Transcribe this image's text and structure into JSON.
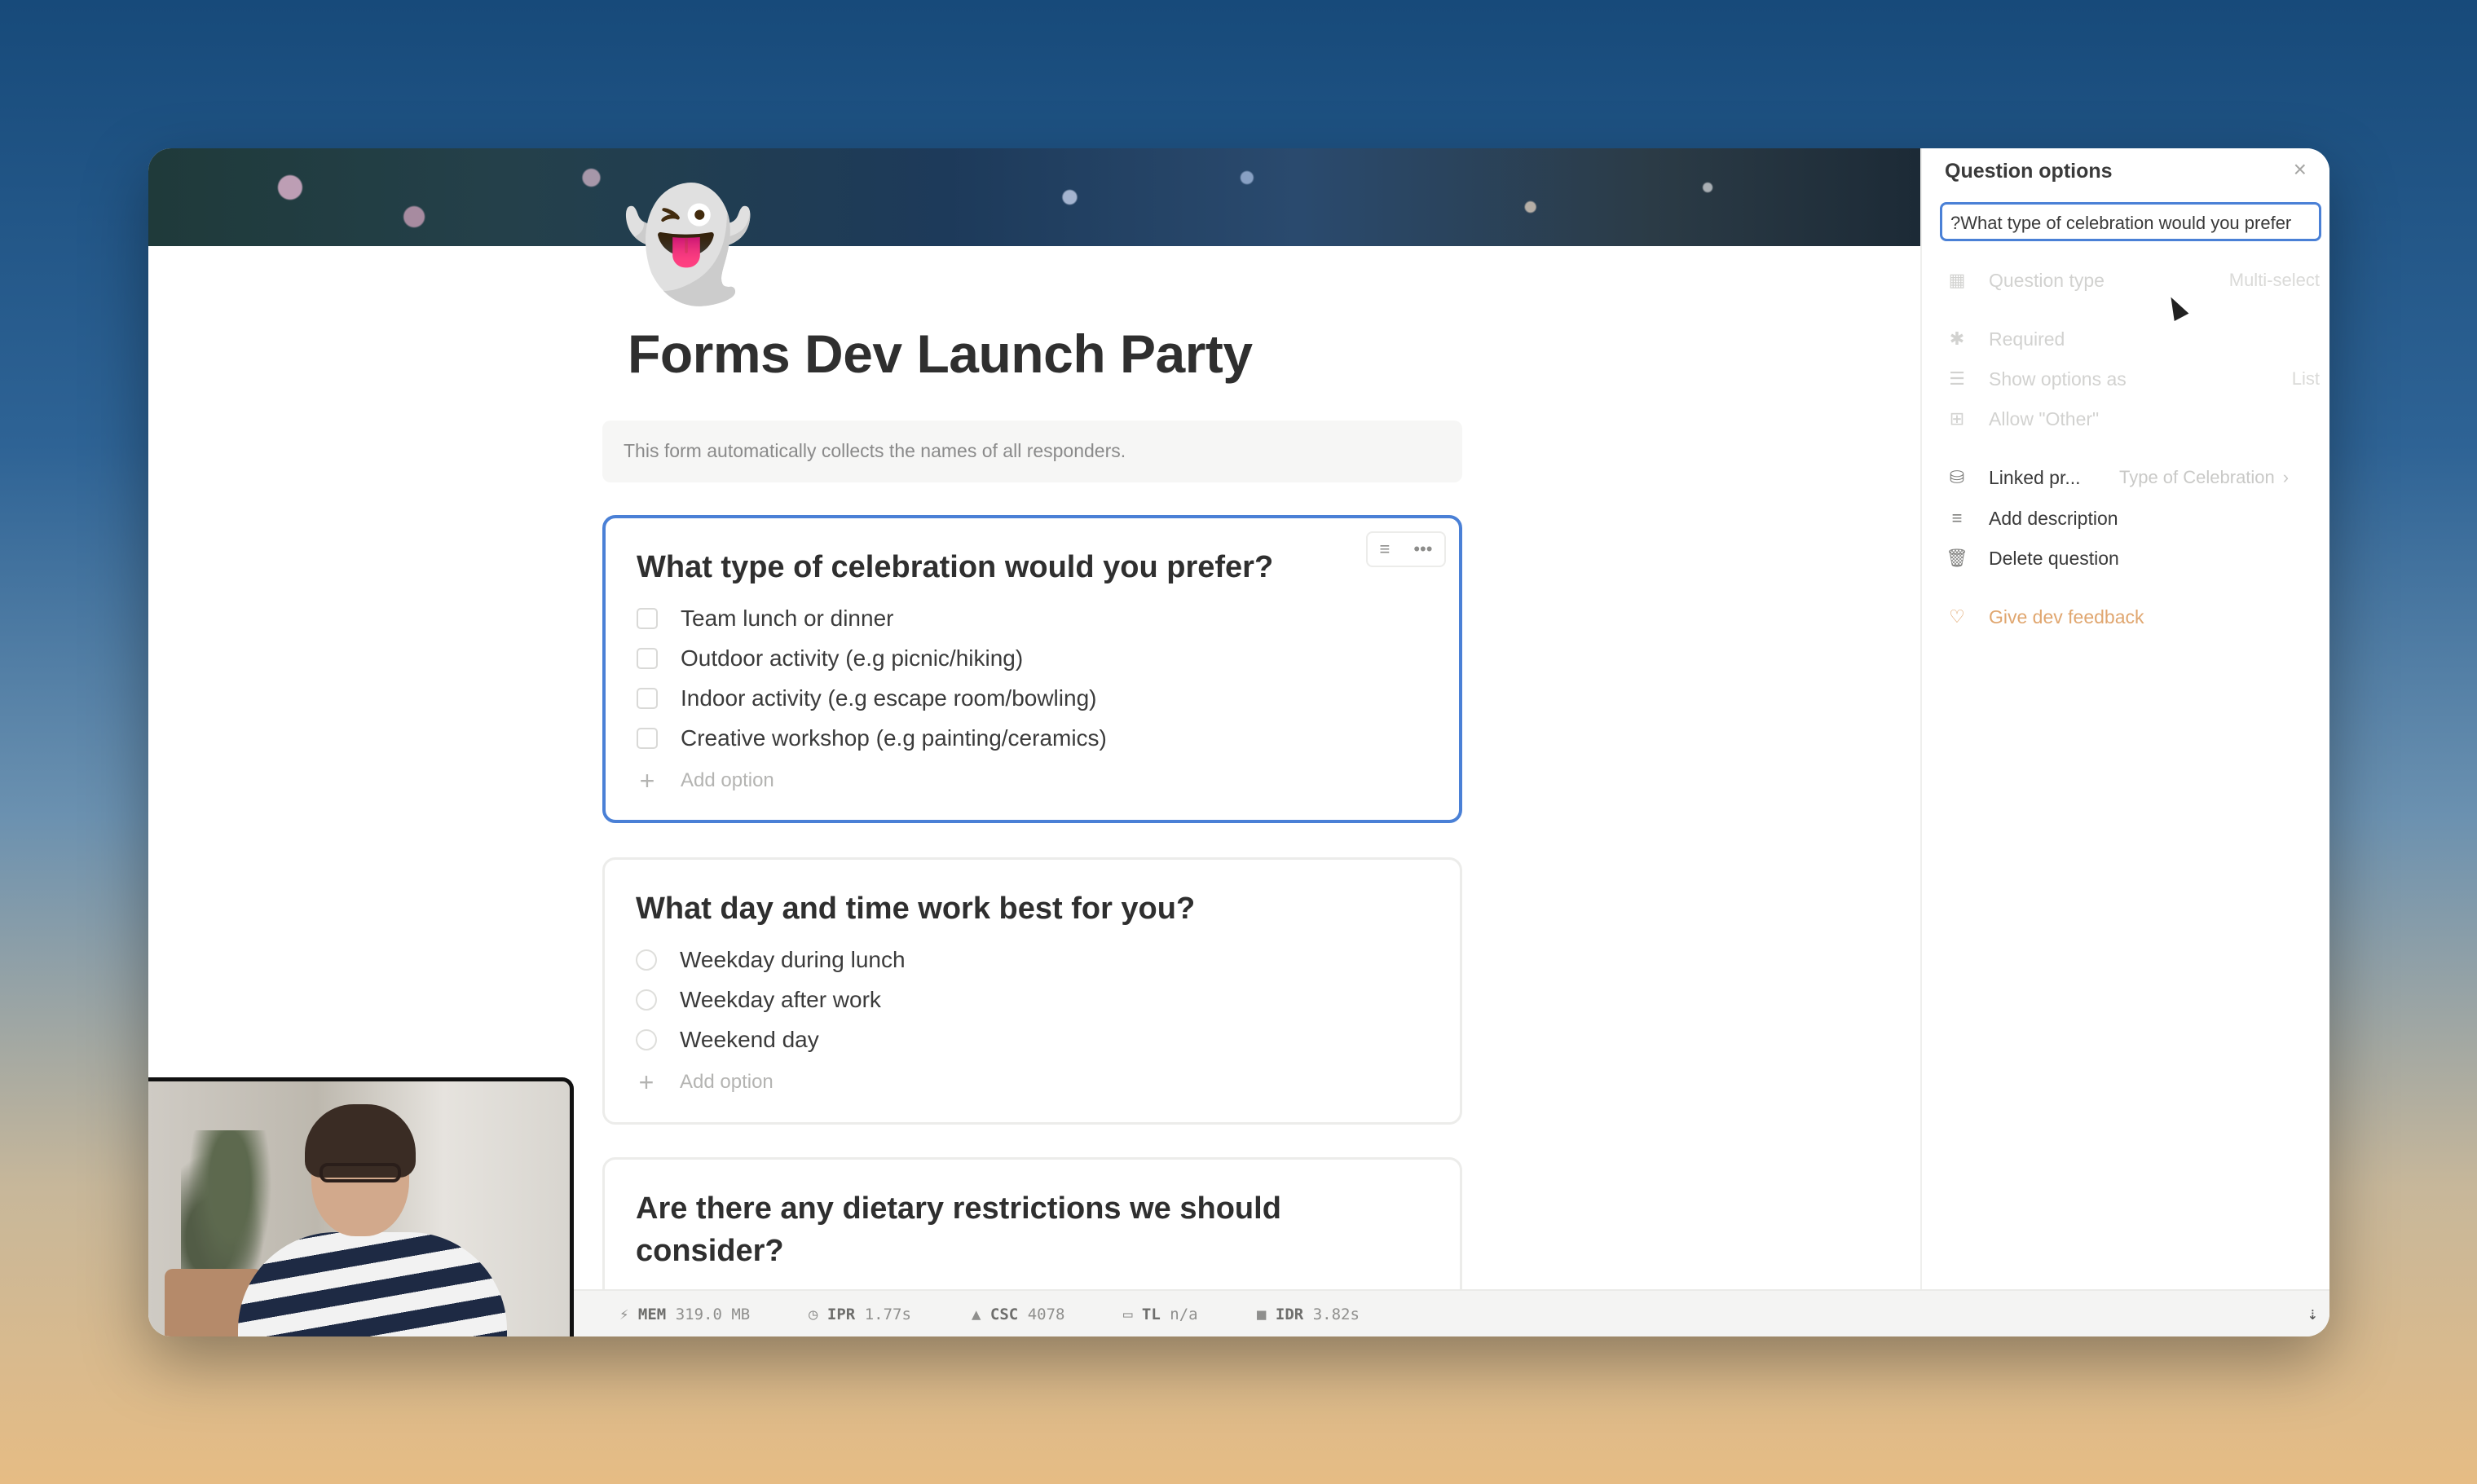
{
  "page": {
    "icon": "ghost-emoji",
    "emoji": "👻",
    "title": "Forms Dev Launch Party",
    "notice": "This form automatically collects the names of all responders."
  },
  "questions": [
    {
      "title": "What type of celebration would you prefer?",
      "kind": "checkbox",
      "options": [
        "Team lunch or dinner",
        "Outdoor activity (e.g picnic/hiking)",
        "Indoor activity (e.g escape room/bowling)",
        "Creative workshop (e.g painting/ceramics)"
      ],
      "add_option": "Add option"
    },
    {
      "title": "What day and time work best for you?",
      "kind": "radio",
      "options": [
        "Weekday during lunch",
        "Weekday after work",
        "Weekend day"
      ],
      "add_option": "Add option"
    },
    {
      "title": "Are there any dietary restrictions we should consider?"
    }
  ],
  "card_tools": {
    "icon_left": "edit-lines-icon",
    "icon_right": "more-dots-icon"
  },
  "panel": {
    "title": "Question options",
    "close": "×",
    "input_value": "What type of celebration would you prefer?",
    "rows": {
      "question_type": {
        "label": "Question type",
        "value": "Multi-select"
      },
      "required": {
        "label": "Required"
      },
      "show_options": {
        "label": "Show options as",
        "value": "List"
      },
      "allow_other": {
        "label": "Allow \"Other\""
      },
      "linked": {
        "label": "Linked pr...",
        "value": "Type of Celebration"
      },
      "add_description": {
        "label": "Add description"
      },
      "delete_question": {
        "label": "Delete question"
      },
      "feedback": {
        "label": "Give dev feedback"
      }
    }
  },
  "status": {
    "mem": {
      "key": "MEM",
      "value": "319.0 MB"
    },
    "ipr": {
      "key": "IPR",
      "value": "1.77s"
    },
    "csc": {
      "key": "CSC",
      "value": "4078"
    },
    "tl": {
      "key": "TL",
      "value": "n/a"
    },
    "idr": {
      "key": "IDR",
      "value": "3.82s"
    }
  },
  "colors": {
    "accent": "#4a80d6",
    "feedback": "#e0a66f"
  }
}
